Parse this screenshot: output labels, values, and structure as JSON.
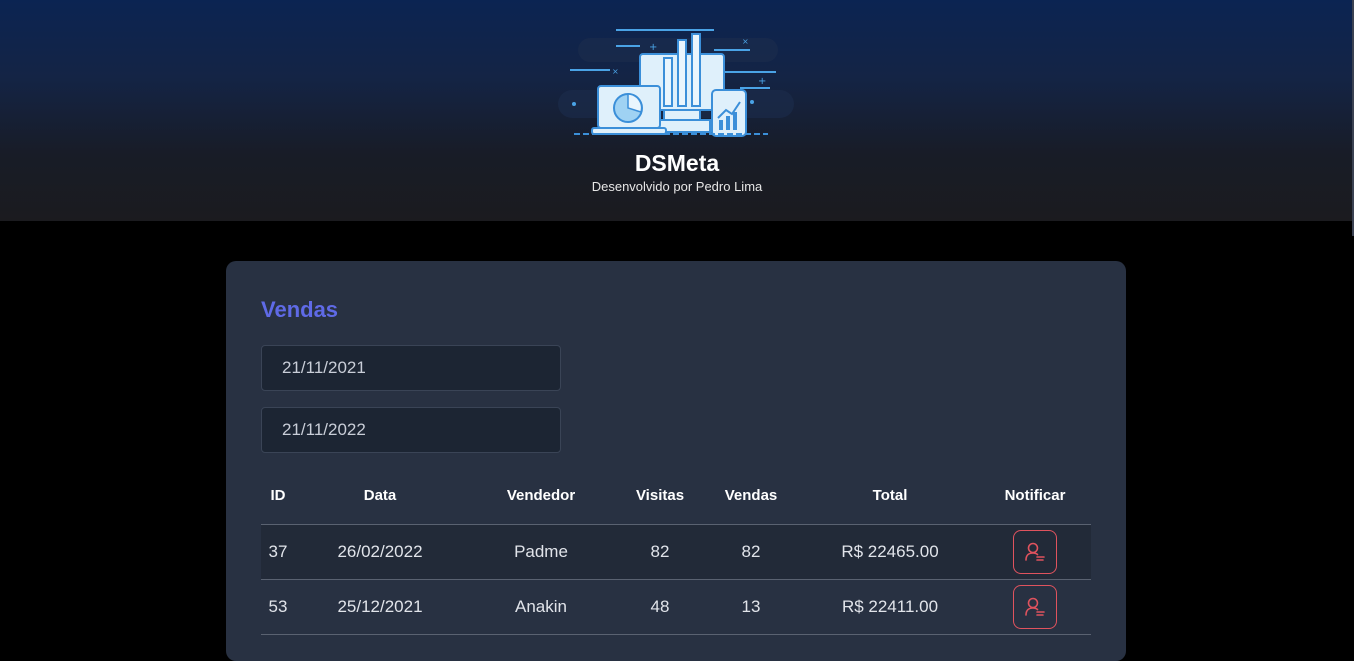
{
  "header": {
    "title": "DSMeta",
    "subtitle": "Desenvolvido por Pedro Lima",
    "logo_icon": "dashboard-devices-illustration"
  },
  "colors": {
    "accent": "#5f6ae6",
    "card_bg": "#283142",
    "input_bg": "#1c2533",
    "notify_red": "#e0535e"
  },
  "sales": {
    "title": "Vendas",
    "min_date": "21/11/2021",
    "max_date": "21/11/2022",
    "columns": [
      "ID",
      "Data",
      "Vendedor",
      "Visitas",
      "Vendas",
      "Total",
      "Notificar"
    ],
    "rows": [
      {
        "id": "37",
        "date": "26/02/2022",
        "seller": "Padme",
        "visits": "82",
        "deals": "82",
        "total": "R$ 22465.00",
        "notify_icon": "user-notify-icon"
      },
      {
        "id": "53",
        "date": "25/12/2021",
        "seller": "Anakin",
        "visits": "48",
        "deals": "13",
        "total": "R$ 22411.00",
        "notify_icon": "user-notify-icon"
      }
    ]
  }
}
